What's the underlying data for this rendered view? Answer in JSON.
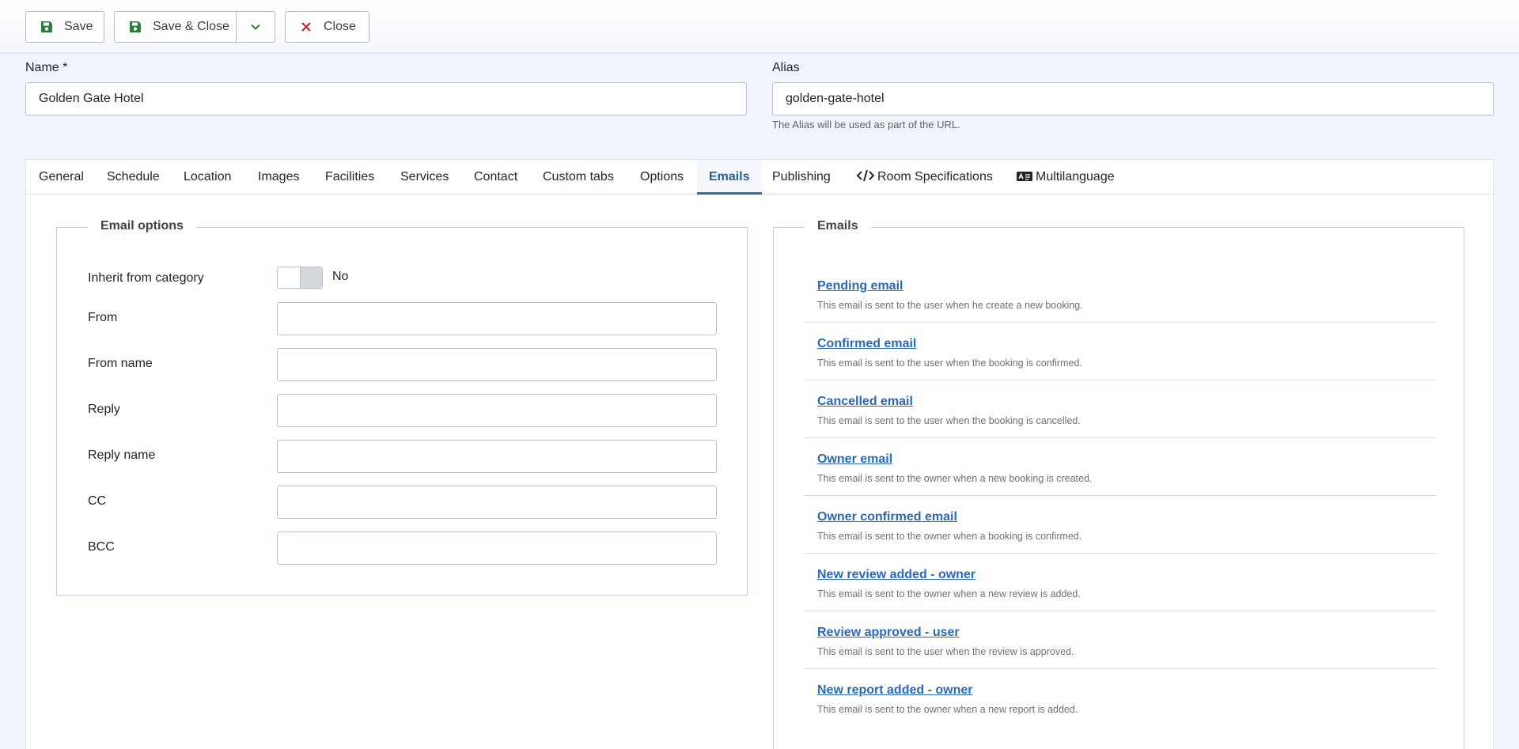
{
  "toolbar": {
    "save_label": "Save",
    "save_close_label": "Save & Close",
    "close_label": "Close",
    "colors": {
      "save_icon": "#2f7d3b",
      "close_icon": "#c0282d"
    }
  },
  "form": {
    "name_label": "Name *",
    "name_value": "Golden Gate Hotel",
    "alias_label": "Alias",
    "alias_value": "golden-gate-hotel",
    "alias_hint": "The Alias will be used as part of the URL."
  },
  "tabs": [
    {
      "label": "General"
    },
    {
      "label": "Schedule"
    },
    {
      "label": "Location"
    },
    {
      "label": "Images"
    },
    {
      "label": "Facilities"
    },
    {
      "label": "Services"
    },
    {
      "label": "Contact"
    },
    {
      "label": "Custom tabs"
    },
    {
      "label": "Options"
    },
    {
      "label": "Emails",
      "active": true
    },
    {
      "label": "Publishing"
    },
    {
      "label": "Room Specifications",
      "icon": "code-icon"
    },
    {
      "label": "Multilanguage",
      "icon": "language-card-icon"
    }
  ],
  "email_options": {
    "legend": "Email options",
    "inherit_label": "Inherit from category",
    "inherit_value": "No",
    "fields": [
      {
        "label": "From",
        "value": ""
      },
      {
        "label": "From name",
        "value": ""
      },
      {
        "label": "Reply",
        "value": ""
      },
      {
        "label": "Reply name",
        "value": ""
      },
      {
        "label": "CC",
        "value": ""
      },
      {
        "label": "BCC",
        "value": ""
      }
    ]
  },
  "emails": {
    "legend": "Emails",
    "items": [
      {
        "title": "Pending email",
        "desc": "This email is sent to the user when he create a new booking."
      },
      {
        "title": "Confirmed email",
        "desc": "This email is sent to the user when the booking is confirmed."
      },
      {
        "title": "Cancelled email",
        "desc": "This email is sent to the user when the booking is cancelled."
      },
      {
        "title": "Owner email",
        "desc": "This email is sent to the owner when a new booking is created."
      },
      {
        "title": "Owner confirmed email",
        "desc": "This email is sent to the owner when a booking is confirmed."
      },
      {
        "title": "New review added - owner",
        "desc": "This email is sent to the owner when a new review is added."
      },
      {
        "title": "Review approved - user",
        "desc": "This email is sent to the user when the review is approved."
      },
      {
        "title": "New report added - owner",
        "desc": "This email is sent to the owner when a new report is added."
      }
    ]
  }
}
